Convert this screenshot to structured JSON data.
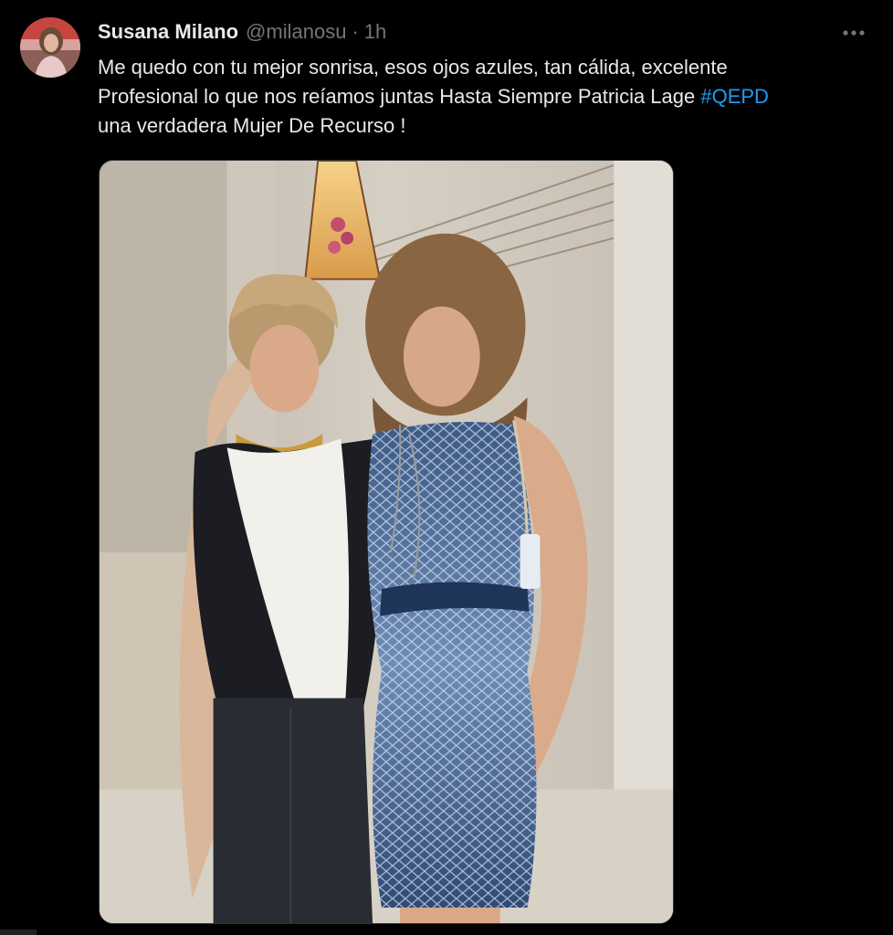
{
  "post": {
    "author_name": "Susana Milano",
    "author_handle": "@milanosu",
    "separator": "·",
    "timestamp": "1h",
    "text_lines": [
      "Me quedo con tu mejor sonrisa, esos ojos azules,  tan cálida, excelente",
      "Profesional lo que nos reíamos juntas Hasta Siempre Patricia Lage ",
      "una verdadera Mujer De Recurso !"
    ],
    "hashtag": "#QEPD",
    "more_icon": "more-horizontal-icon",
    "avatar_icon": "user-avatar",
    "media_icon": "photo"
  },
  "colors": {
    "background": "#000000",
    "text": "#e7e9ea",
    "secondary": "#71767b",
    "link": "#1d9bf0"
  }
}
